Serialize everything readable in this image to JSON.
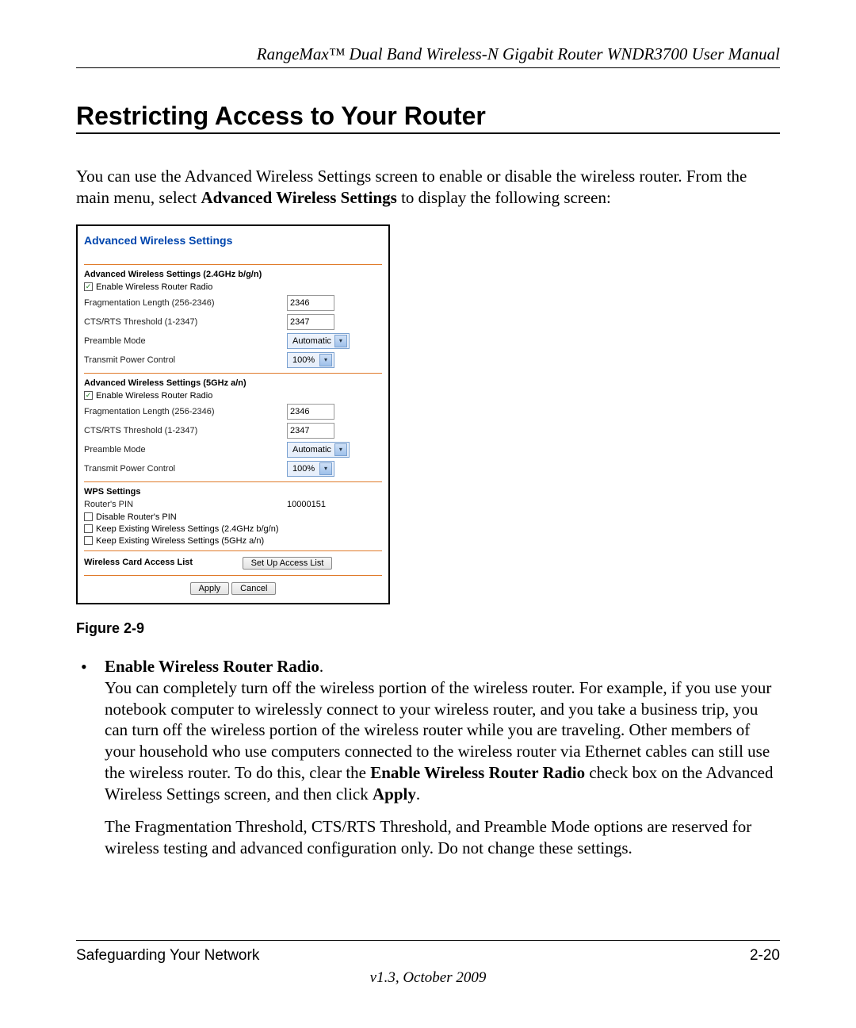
{
  "header": "RangeMax™ Dual Band Wireless-N Gigabit Router WNDR3700 User Manual",
  "section_title": "Restricting Access to Your Router",
  "intro_pre": "You can use the Advanced Wireless Settings screen to enable or disable the wireless router. From the main menu, select ",
  "intro_bold": "Advanced Wireless Settings",
  "intro_post": " to display the following screen:",
  "screenshot": {
    "title": "Advanced Wireless Settings",
    "group24": {
      "title": "Advanced Wireless Settings (2.4GHz b/g/n)",
      "enable_radio": "Enable Wireless Router Radio",
      "frag_label": "Fragmentation Length (256-2346)",
      "frag_value": "2346",
      "cts_label": "CTS/RTS Threshold (1-2347)",
      "cts_value": "2347",
      "preamble_label": "Preamble Mode",
      "preamble_value": "Automatic",
      "tx_label": "Transmit Power Control",
      "tx_value": "100%"
    },
    "group5": {
      "title": "Advanced Wireless Settings (5GHz a/n)",
      "enable_radio": "Enable Wireless Router Radio",
      "frag_label": "Fragmentation Length (256-2346)",
      "frag_value": "2346",
      "cts_label": "CTS/RTS Threshold (1-2347)",
      "cts_value": "2347",
      "preamble_label": "Preamble Mode",
      "preamble_value": "Automatic",
      "tx_label": "Transmit Power Control",
      "tx_value": "100%"
    },
    "wps": {
      "title": "WPS Settings",
      "pin_label": "Router's PIN",
      "pin_value": "10000151",
      "disable_pin": "Disable Router's PIN",
      "keep24": "Keep Existing Wireless Settings (2.4GHz b/g/n)",
      "keep5": "Keep Existing Wireless Settings (5GHz a/n)"
    },
    "acl_label": "Wireless Card Access List",
    "acl_button": "Set Up Access List",
    "apply": "Apply",
    "cancel": "Cancel"
  },
  "figure_label": "Figure 2-9",
  "bullet": {
    "head": "Enable Wireless Router Radio",
    "p1_pre": "You can completely turn off the wireless portion of the wireless router. For example, if you use your notebook computer to wirelessly connect to your wireless router, and you take a business trip, you can turn off the wireless portion of the wireless router while you are traveling. Other members of your household who use computers connected to the wireless router via Ethernet cables can still use the wireless router. To do this, clear the ",
    "p1_bold1": "Enable Wireless Router Radio",
    "p1_mid": " check box on the Advanced Wireless Settings screen, and then click ",
    "p1_bold2": "Apply",
    "p1_end": ".",
    "p2": "The Fragmentation Threshold, CTS/RTS Threshold, and Preamble Mode options are reserved for wireless testing and advanced configuration only. Do not change these settings."
  },
  "footer": {
    "left": "Safeguarding Your Network",
    "right": "2-20",
    "center": "v1.3, October 2009"
  }
}
